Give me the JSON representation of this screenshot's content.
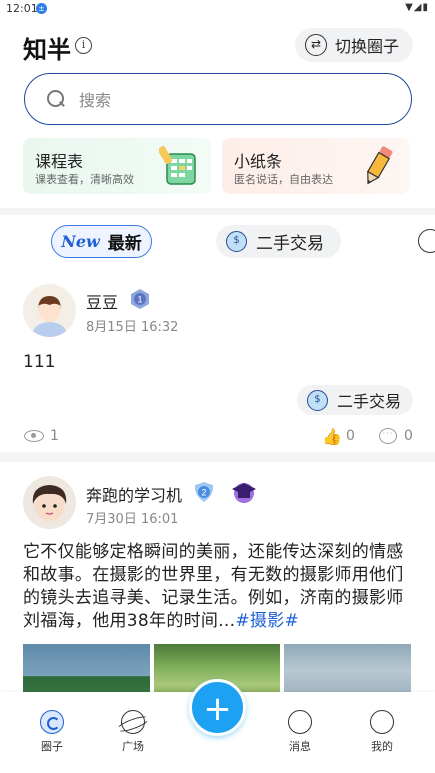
{
  "status_bar": {
    "time": "12:01",
    "notif": "±",
    "icons": "▼◢▮"
  },
  "header": {
    "title": "知半",
    "info_glyph": "i",
    "switch_label": "切换圈子",
    "switch_glyph": "⇄"
  },
  "search": {
    "placeholder": "搜索"
  },
  "cards": [
    {
      "title": "课程表",
      "subtitle": "课表查看，清晰高效",
      "icon": "schedule-icon"
    },
    {
      "title": "小纸条",
      "subtitle": "匿名说话，自由表达",
      "icon": "pencil-icon"
    }
  ],
  "tabs": {
    "new_badge": "New",
    "latest": "最新",
    "trade": "二手交易",
    "trade_glyph": "$"
  },
  "posts": [
    {
      "author": "豆豆",
      "level": "1",
      "time": "8月15日 16:32",
      "text": "111",
      "tag": "二手交易",
      "views": "1",
      "likes": "0",
      "comments": "0",
      "like_glyph": "👍",
      "comment_glyph": "···"
    },
    {
      "author": "奔跑的学习机",
      "level": "2",
      "time": "7月30日 16:01",
      "text": "它不仅能够定格瞬间的美丽，还能传达深刻的情感和故事。在摄影的世界里，有无数的摄影师用他们的镜头去追寻美、记录生活。例如，济南的摄影师刘福海，他用38年的时间...",
      "topic": "#摄影#"
    }
  ],
  "bottom_nav": {
    "items": [
      {
        "label": "圈子",
        "icon": "circle-icon",
        "active": true
      },
      {
        "label": "广场",
        "icon": "planet-icon"
      },
      {
        "label": "消息",
        "icon": "message-icon"
      },
      {
        "label": "我的",
        "icon": "profile-icon"
      }
    ],
    "fab": "+"
  },
  "colors": {
    "accent": "#1e5fd6",
    "fab": "#1da1f2",
    "search_border": "#1f4b9b"
  }
}
